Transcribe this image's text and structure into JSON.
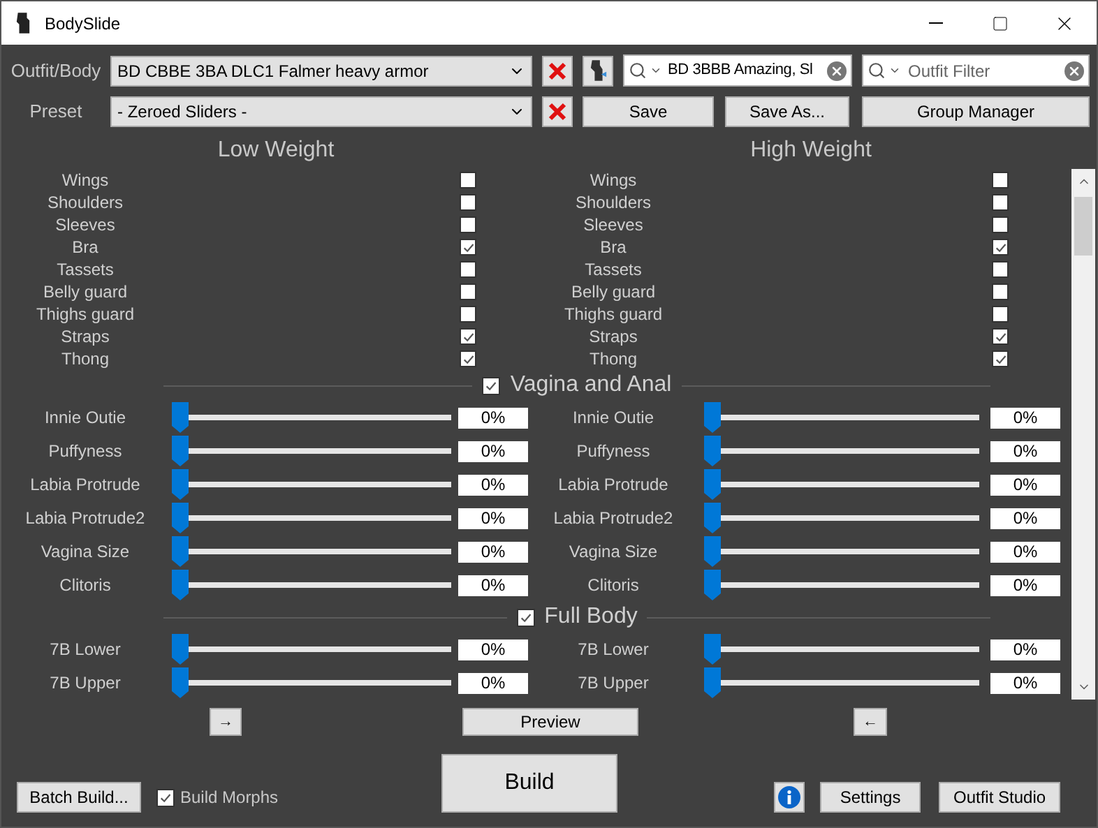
{
  "window": {
    "title": "BodySlide"
  },
  "outfit": {
    "label": "Outfit/Body",
    "value": "BD CBBE 3BA DLC1 Falmer heavy armor"
  },
  "outfit_search": {
    "value": "BD 3BBB Amazing, Sl"
  },
  "outfit_filter": {
    "placeholder": "Outfit Filter"
  },
  "preset": {
    "label": "Preset",
    "value": "- Zeroed Sliders -"
  },
  "preset_buttons": [
    "Save",
    "Save As...",
    "Group Manager"
  ],
  "columns": [
    "Low Weight",
    "High Weight"
  ],
  "zaps": [
    {
      "low": {
        "label": "Wings",
        "checked": false
      },
      "high": {
        "label": "Wings",
        "checked": false
      }
    },
    {
      "low": {
        "label": "Shoulders",
        "checked": false
      },
      "high": {
        "label": "Shoulders",
        "checked": false
      }
    },
    {
      "low": {
        "label": "Sleeves",
        "checked": false
      },
      "high": {
        "label": "Sleeves",
        "checked": false
      }
    },
    {
      "low": {
        "label": "Bra",
        "checked": true
      },
      "high": {
        "label": "Bra",
        "checked": true
      }
    },
    {
      "low": {
        "label": "Tassets",
        "checked": false
      },
      "high": {
        "label": "Tassets",
        "checked": false
      }
    },
    {
      "low": {
        "label": "Belly guard",
        "checked": false
      },
      "high": {
        "label": "Belly guard",
        "checked": false
      }
    },
    {
      "low": {
        "label": "Thighs guard",
        "checked": false
      },
      "high": {
        "label": "Thighs guard",
        "checked": false
      }
    },
    {
      "low": {
        "label": "Straps",
        "checked": true
      },
      "high": {
        "label": "Straps",
        "checked": true
      }
    },
    {
      "low": {
        "label": "Thong",
        "checked": true
      },
      "high": {
        "label": "Thong",
        "checked": true
      }
    }
  ],
  "groups": [
    {
      "name": "Vagina and Anal",
      "checked": true,
      "sliders": [
        {
          "low": {
            "label": "Innie Outie",
            "level": 0,
            "reading": "0%"
          },
          "high": {
            "label": "Innie Outie",
            "level": 0,
            "reading": "0%"
          }
        },
        {
          "low": {
            "label": "Puffyness",
            "level": 0,
            "reading": "0%"
          },
          "high": {
            "label": "Puffyness",
            "level": 0,
            "reading": "0%"
          }
        },
        {
          "low": {
            "label": "Labia Protrude",
            "level": 0,
            "reading": "0%"
          },
          "high": {
            "label": "Labia Protrude",
            "level": 0,
            "reading": "0%"
          }
        },
        {
          "low": {
            "label": "Labia Protrude2",
            "level": 0,
            "reading": "0%"
          },
          "high": {
            "label": "Labia Protrude2",
            "level": 0,
            "reading": "0%"
          }
        },
        {
          "low": {
            "label": "Vagina Size",
            "level": 0,
            "reading": "0%"
          },
          "high": {
            "label": "Vagina Size",
            "level": 0,
            "reading": "0%"
          }
        },
        {
          "low": {
            "label": "Clitoris",
            "level": 0,
            "reading": "0%"
          },
          "high": {
            "label": "Clitoris",
            "level": 0,
            "reading": "0%"
          }
        }
      ]
    },
    {
      "name": "Full Body",
      "checked": true,
      "sliders": [
        {
          "low": {
            "label": "7B Lower",
            "level": 0,
            "reading": "0%"
          },
          "high": {
            "label": "7B Lower",
            "level": 0,
            "reading": "0%"
          }
        },
        {
          "low": {
            "label": "7B Upper",
            "level": 0,
            "reading": "0%"
          },
          "high": {
            "label": "7B Upper",
            "level": 0,
            "reading": "0%"
          }
        }
      ]
    }
  ],
  "nav": {
    "copy_right": "→",
    "preview": "Preview",
    "copy_left": "←"
  },
  "build": "Build",
  "batch_build": "Batch Build...",
  "build_morphs": {
    "label": "Build Morphs",
    "checked": true
  },
  "footer_buttons": [
    "Settings",
    "Outfit Studio"
  ]
}
